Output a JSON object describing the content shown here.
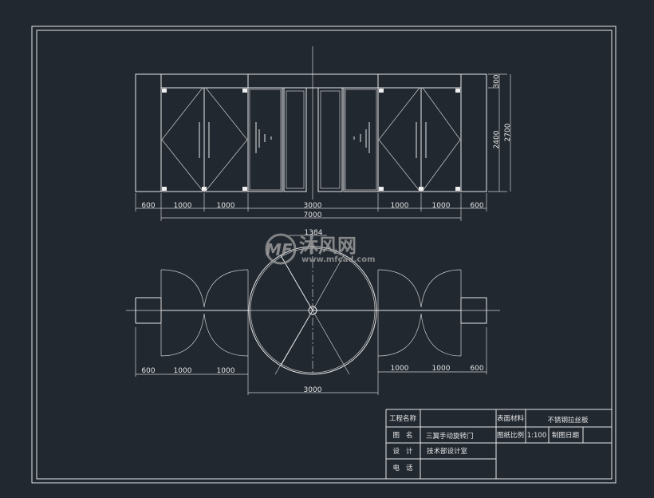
{
  "colors": {
    "background": "#212830",
    "lines": "#e8e8e8",
    "watermark": "#9a9a9a"
  },
  "elevation": {
    "dims_bottom": [
      "600",
      "1000",
      "1000",
      "3000",
      "1000",
      "1000",
      "600"
    ],
    "overall_width": "7000",
    "dims_right": {
      "top": "300",
      "door_height": "2400",
      "total_height": "2700"
    }
  },
  "plan": {
    "radius_label": "1384",
    "dims_left": [
      "600",
      "1000",
      "1000"
    ],
    "dims_right": [
      "1000",
      "1000",
      "600"
    ],
    "drum_diameter": "3000"
  },
  "watermark": {
    "brand": "沐风网",
    "url": "www.mfcad.com",
    "logo": "MF"
  },
  "title_block": {
    "project_name_label": "工程名称",
    "project_name_value": "",
    "surface_material_label": "表面材料",
    "surface_material_value": "不锈钢拉丝板",
    "drawing_name_label": "图   名",
    "drawing_name_value": "三翼手动旋转门",
    "scale_label": "图纸比例",
    "scale_value": "1:100",
    "date_label": "制图日期",
    "date_value": "",
    "design_label": "设   计",
    "design_value": "技术部设计室",
    "phone_label": "电   话",
    "phone_value": ""
  }
}
